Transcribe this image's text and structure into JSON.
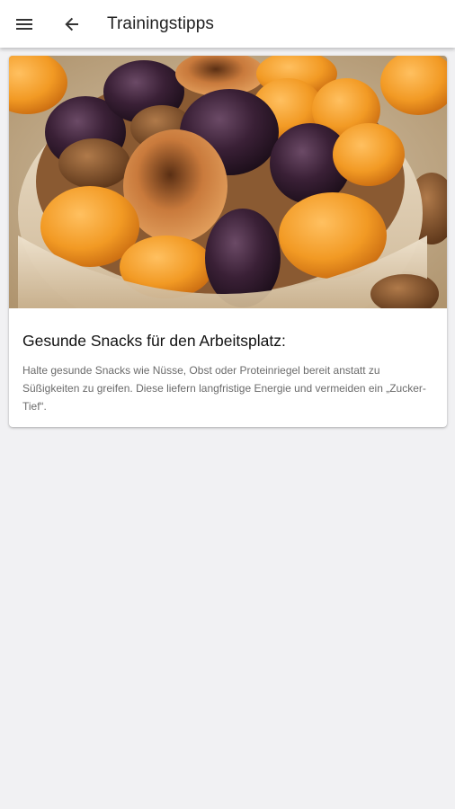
{
  "app_bar": {
    "title": "Trainingstipps",
    "menu_icon": "menu-icon",
    "back_icon": "arrow-back-icon"
  },
  "card": {
    "image_subject": "bowl of dried fruits: apricots, prunes, figs, dates",
    "title": "Gesunde Snacks für den Arbeitsplatz:",
    "text": "Halte gesunde Snacks wie Nüsse, Obst oder Proteinriegel bereit anstatt zu Süßigkeiten zu greifen. Diese liefern langfristige Energie und vermeiden ein „Zucker-Tief“."
  },
  "colors": {
    "background": "#f1f1f3",
    "app_bar": "#ffffff",
    "card": "#ffffff",
    "title_text": "#222222",
    "body_text": "#6b6b6b"
  }
}
